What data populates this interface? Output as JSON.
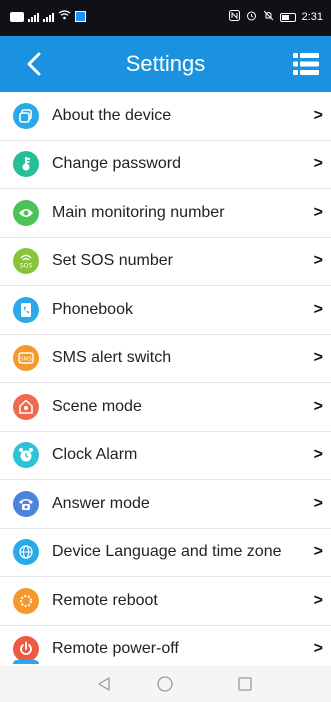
{
  "status_bar": {
    "left_text": "HD",
    "time": "2:31"
  },
  "header": {
    "title": "Settings",
    "back_icon": "chevron-left-icon",
    "menu_icon": "list-menu-icon"
  },
  "menu": {
    "chevron": ">",
    "items": [
      {
        "label": "About the device",
        "icon": "device-info-icon",
        "color": "#2aa9e8"
      },
      {
        "label": "Change password",
        "icon": "key-icon",
        "color": "#25c09a"
      },
      {
        "label": "Main monitoring number",
        "icon": "eye-icon",
        "color": "#4cc356"
      },
      {
        "label": "Set SOS number",
        "icon": "sos-icon",
        "color": "#8ac33a"
      },
      {
        "label": "Phonebook",
        "icon": "phonebook-icon",
        "color": "#2aa9e8"
      },
      {
        "label": "SMS alert switch",
        "icon": "sms-icon",
        "color": "#f59a2a"
      },
      {
        "label": "Scene mode",
        "icon": "home-icon",
        "color": "#ef6a4f"
      },
      {
        "label": "Clock Alarm",
        "icon": "alarm-clock-icon",
        "color": "#2ec2d6"
      },
      {
        "label": "Answer mode",
        "icon": "phone-icon",
        "color": "#4c83db"
      },
      {
        "label": "Device Language and time zone",
        "icon": "globe-icon",
        "color": "#2aa9e8"
      },
      {
        "label": "Remote reboot",
        "icon": "reboot-icon",
        "color": "#f59a2a"
      },
      {
        "label": "Remote power-off",
        "icon": "power-icon",
        "color": "#ef5a46"
      }
    ]
  },
  "nav_bar": {
    "back": "triangle-back-icon",
    "home": "circle-home-icon",
    "recents": "square-recents-icon"
  }
}
